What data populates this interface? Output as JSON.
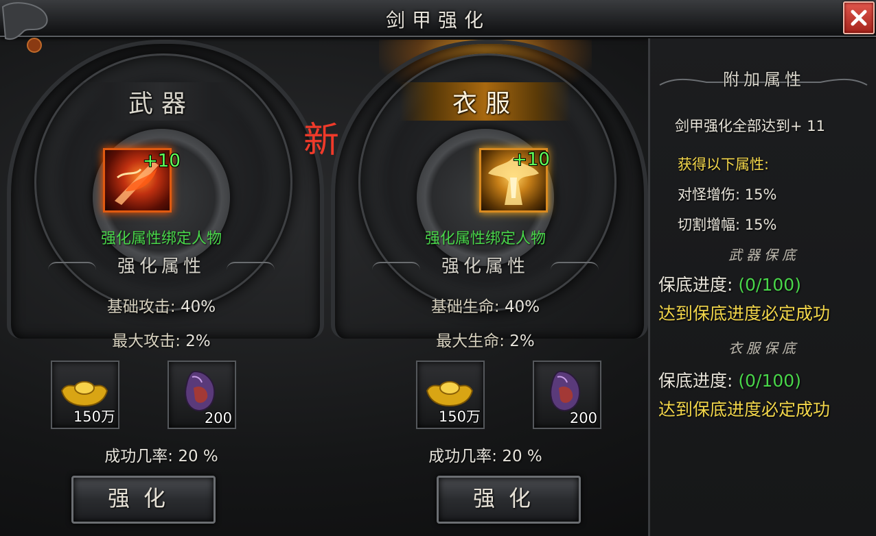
{
  "window": {
    "title": "剑甲强化"
  },
  "new_label": "新",
  "panels": [
    {
      "title": "武器",
      "item_level": "+10",
      "bind_text": "强化属性绑定人物",
      "attr_heading": "强化属性",
      "stats": [
        {
          "label": "基础攻击:",
          "value": "40%"
        },
        {
          "label": "最大攻击:",
          "value": "2%"
        }
      ],
      "materials": [
        {
          "icon": "gold-ingot-icon",
          "qty": "150万"
        },
        {
          "icon": "crystal-stone-icon",
          "qty": "200"
        }
      ],
      "success_rate_label": "成功几率:",
      "success_rate_value": "20 %",
      "button_label": "强化"
    },
    {
      "title": "衣服",
      "item_level": "+10",
      "bind_text": "强化属性绑定人物",
      "attr_heading": "强化属性",
      "stats": [
        {
          "label": "基础生命:",
          "value": "40%"
        },
        {
          "label": "最大生命:",
          "value": "2%"
        }
      ],
      "materials": [
        {
          "icon": "gold-ingot-icon",
          "qty": "150万"
        },
        {
          "icon": "crystal-stone-icon",
          "qty": "200"
        }
      ],
      "success_rate_label": "成功几率:",
      "success_rate_value": "20 %",
      "button_label": "强化"
    }
  ],
  "side": {
    "heading": "附加属性",
    "condition": "剑甲强化全部达到+ 11",
    "gain_label": "获得以下属性:",
    "bonuses": [
      {
        "label": "对怪增伤:",
        "value": "15%"
      },
      {
        "label": "切割增幅:",
        "value": "15%"
      }
    ],
    "weapon_pity": {
      "heading": "武器保底",
      "label": "保底进度:",
      "value": "(0/100)",
      "note": "达到保底进度必定成功"
    },
    "armor_pity": {
      "heading": "衣服保底",
      "label": "保底进度:",
      "value": "(0/100)",
      "note": "达到保底进度必定成功"
    }
  },
  "colors": {
    "accent_gold": "#f2d64a",
    "accent_green": "#49d64a",
    "new_red": "#f03a2a",
    "close_red": "#c8372c"
  }
}
